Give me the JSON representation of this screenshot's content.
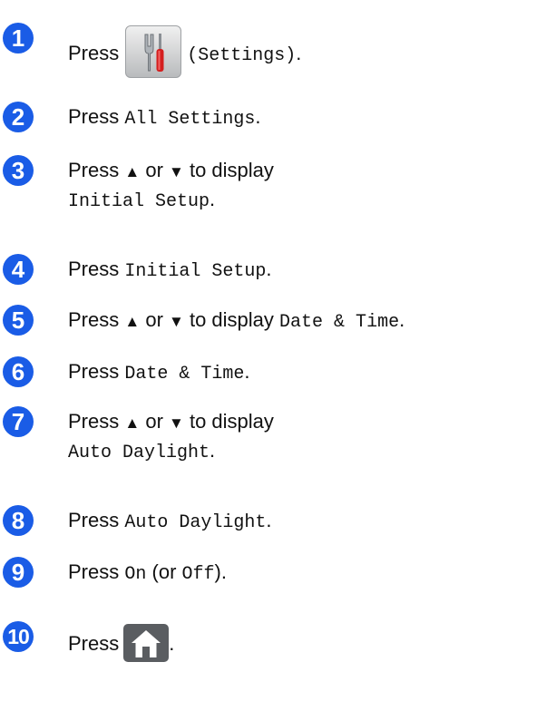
{
  "steps": [
    {
      "number": "1",
      "press": "Press",
      "label": "(Settings)",
      "trail": "."
    },
    {
      "number": "2",
      "press": "Press",
      "label": "All Settings",
      "trail": "."
    },
    {
      "number": "3",
      "text": "Press",
      "up": "▲",
      "or": "or",
      "down": "▼",
      "to": "to display",
      "label": "Initial Setup",
      "trail": "."
    },
    {
      "number": "4",
      "press": "Press",
      "label": "Initial Setup",
      "trail": "."
    },
    {
      "number": "5",
      "text": "Press",
      "up": "▲",
      "or": "or",
      "down": "▼",
      "to": "to display",
      "label": "Date & Time",
      "trail": "."
    },
    {
      "number": "6",
      "press": "Press",
      "label": "Date & Time",
      "trail": "."
    },
    {
      "number": "7",
      "text": "Press",
      "up": "▲",
      "or": "or",
      "down": "▼",
      "to": "to display",
      "label": "Auto Daylight",
      "trail": "."
    },
    {
      "number": "8",
      "press": "Press",
      "label": "Auto Daylight",
      "trail": "."
    },
    {
      "number": "9",
      "press": "Press",
      "on": "On",
      "paren_open": "(or",
      "off": "Off",
      "paren_close": ")."
    },
    {
      "number": "10",
      "press": "Press",
      "trail": "."
    }
  ],
  "icons": {
    "settings": "settings-wrench-screwdriver-icon",
    "home": "home-icon"
  },
  "colors": {
    "step_badge": "#1a5ce6",
    "text": "#111111"
  }
}
